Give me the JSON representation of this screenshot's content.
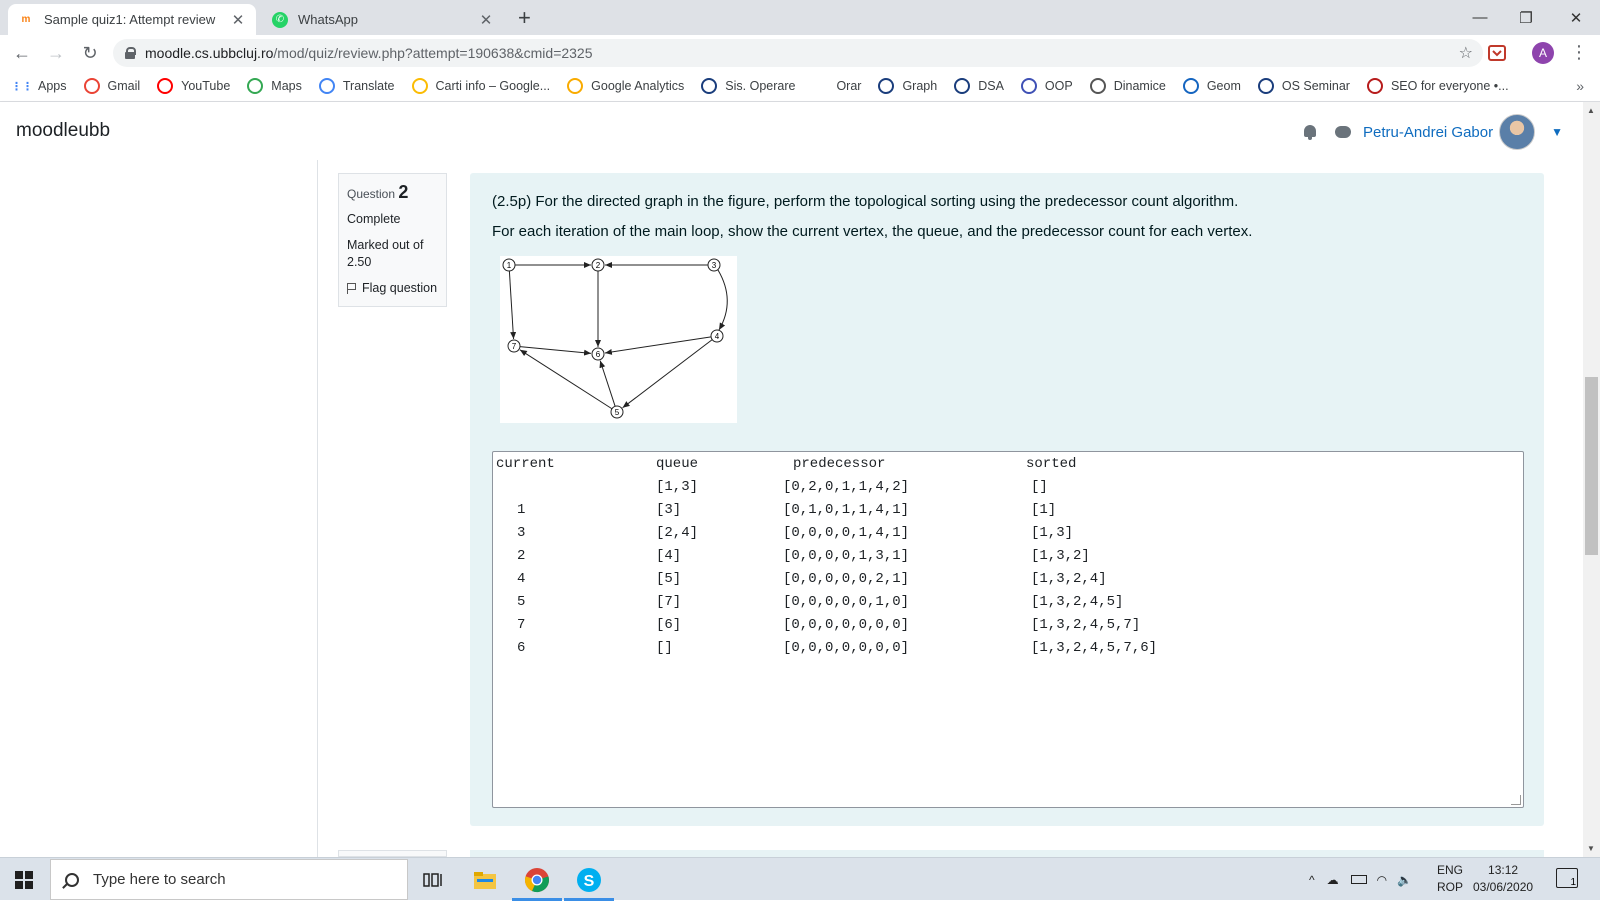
{
  "browser": {
    "tabs": [
      {
        "title": "Sample quiz1: Attempt review",
        "active": true
      },
      {
        "title": "WhatsApp",
        "active": false
      }
    ],
    "url_host": "moodle.cs.ubbcluj.ro",
    "url_path": "/mod/quiz/review.php?attempt=190638&cmid=2325",
    "profile_initial": "A"
  },
  "bookmarks": [
    {
      "label": "Apps",
      "icon": "apps-grid-icon",
      "color": "#4285f4"
    },
    {
      "label": "Gmail",
      "icon": "gmail-icon",
      "color": "#ea4335"
    },
    {
      "label": "YouTube",
      "icon": "youtube-icon",
      "color": "#ff0000"
    },
    {
      "label": "Maps",
      "icon": "maps-icon",
      "color": "#34a853"
    },
    {
      "label": "Translate",
      "icon": "translate-icon",
      "color": "#4285f4"
    },
    {
      "label": "Carti info – Google...",
      "icon": "drive-icon",
      "color": "#fbbc04"
    },
    {
      "label": "Google Analytics",
      "icon": "analytics-icon",
      "color": "#f9ab00"
    },
    {
      "label": "Sis. Operare",
      "icon": "globe-icon",
      "color": "#1a3d7c"
    },
    {
      "label": "Orar",
      "icon": "",
      "color": ""
    },
    {
      "label": "Graph",
      "icon": "globe-icon",
      "color": "#1a3d7c"
    },
    {
      "label": "DSA",
      "icon": "globe-icon",
      "color": "#1a3d7c"
    },
    {
      "label": "OOP",
      "icon": "forms-icon",
      "color": "#3f51b5"
    },
    {
      "label": "Dinamice",
      "icon": "globe-icon",
      "color": "#555555"
    },
    {
      "label": "Geom",
      "icon": "bird-icon",
      "color": "#1565c0"
    },
    {
      "label": "OS Seminar",
      "icon": "globe-icon",
      "color": "#1a3d7c"
    },
    {
      "label": "SEO for everyone •...",
      "icon": "seo-icon",
      "color": "#b71c1c"
    }
  ],
  "moodle": {
    "brand": "moodleubb",
    "user_name": "Petru-Andrei Gabor"
  },
  "question": {
    "label": "Question",
    "number": "2",
    "status": "Complete",
    "marks": "Marked out of 2.50",
    "flag_label": "Flag question",
    "text_line1": "(2.5p) For the directed graph in the figure, perform the topological sorting using the predecessor count algorithm.",
    "text_line2": "For each iteration of the main loop, show the current vertex, the queue, and the predecessor count for each vertex."
  },
  "graph_figure": {
    "nodes": [
      "1",
      "2",
      "3",
      "4",
      "5",
      "6",
      "7"
    ],
    "edges": [
      [
        "1",
        "2"
      ],
      [
        "3",
        "2"
      ],
      [
        "1",
        "7"
      ],
      [
        "2",
        "6"
      ],
      [
        "3",
        "4"
      ],
      [
        "7",
        "6"
      ],
      [
        "4",
        "6"
      ],
      [
        "4",
        "5"
      ],
      [
        "5",
        "7"
      ],
      [
        "5",
        "6"
      ]
    ]
  },
  "answer": {
    "headers": [
      "current",
      "queue",
      "predecessor",
      "sorted"
    ],
    "rows": [
      {
        "current": "",
        "queue": "[1,3]",
        "predecessor": "[0,2,0,1,1,4,2]",
        "sorted": "[]"
      },
      {
        "current": "1",
        "queue": "[3]",
        "predecessor": "[0,1,0,1,1,4,1]",
        "sorted": "[1]"
      },
      {
        "current": "3",
        "queue": "[2,4]",
        "predecessor": "[0,0,0,0,1,4,1]",
        "sorted": "[1,3]"
      },
      {
        "current": "2",
        "queue": "[4]",
        "predecessor": "[0,0,0,0,1,3,1]",
        "sorted": "[1,3,2]"
      },
      {
        "current": "4",
        "queue": "[5]",
        "predecessor": "[0,0,0,0,0,2,1]",
        "sorted": "[1,3,2,4]"
      },
      {
        "current": "5",
        "queue": "[7]",
        "predecessor": "[0,0,0,0,0,1,0]",
        "sorted": "[1,3,2,4,5]"
      },
      {
        "current": "7",
        "queue": "[6]",
        "predecessor": "[0,0,0,0,0,0,0]",
        "sorted": "[1,3,2,4,5,7]"
      },
      {
        "current": "6",
        "queue": "[]",
        "predecessor": "[0,0,0,0,0,0,0]",
        "sorted": "[1,3,2,4,5,7,6]"
      }
    ]
  },
  "taskbar": {
    "search_placeholder": "Type here to search",
    "lang_line1": "ENG",
    "lang_line2": "ROP",
    "time": "13:12",
    "date": "03/06/2020",
    "notifications": "1"
  }
}
